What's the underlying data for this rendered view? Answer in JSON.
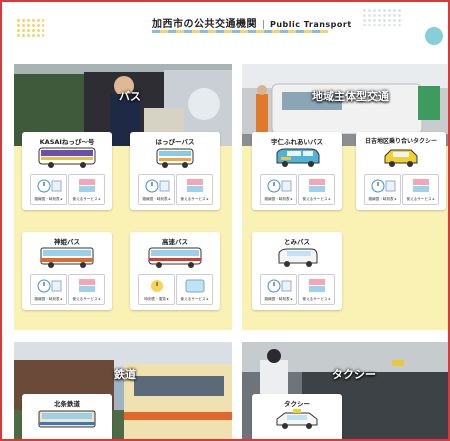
{
  "header": {
    "title_ja": "加西市の公共交通機関",
    "title_en": "Public Transport"
  },
  "sections": {
    "bus": {
      "title": "バス",
      "cards": [
        {
          "name": "KASAIねっぴ〜号",
          "btn1": "路線図・時刻表 ▸",
          "btn2": "使えるサービス ▸"
        },
        {
          "name": "はっぴーバス",
          "btn1": "路線図・時刻表 ▸",
          "btn2": "使えるサービス ▸"
        },
        {
          "name": "神姫バス",
          "btn1": "路線図・時刻表 ▸",
          "btn2": "使えるサービス ▸"
        },
        {
          "name": "高速バス",
          "btn1": "時刻表・運賃 ▸",
          "btn2": "使えるサービス ▸"
        }
      ]
    },
    "community": {
      "title": "地域主体型交通",
      "cards": [
        {
          "name": "宇仁ふれあいバス",
          "btn1": "路線図・時刻表 ▸",
          "btn2": "使えるサービス ▸"
        },
        {
          "name": "日吉地区乗り合いタクシー",
          "btn1": "路線図・時刻表 ▸",
          "btn2": "使えるサービス ▸"
        },
        {
          "name": "とみバス",
          "btn1": "路線図・時刻表 ▸",
          "btn2": "使えるサービス ▸"
        }
      ]
    },
    "rail": {
      "title": "鉄道",
      "cards": [
        {
          "name": "北条鉄道"
        }
      ]
    },
    "taxi": {
      "title": "タクシー",
      "cards": [
        {
          "name": "タクシー"
        }
      ]
    }
  },
  "icons": {
    "timetable": "clock-route-icon",
    "service": "card-icon",
    "ic_card": "ic-card-icon"
  },
  "colors": {
    "frame": "#d83a3a",
    "panel": "#faf1b4",
    "accent_blue": "#7cc3d6",
    "accent_yellow": "#f5d56a"
  }
}
